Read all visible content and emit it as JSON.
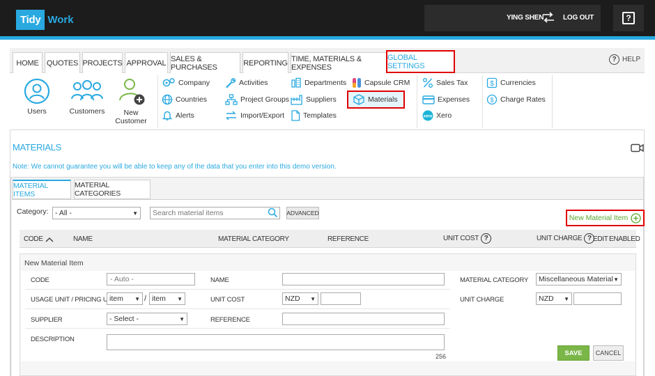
{
  "brand": {
    "logo_left": "Tidy",
    "logo_right": "Work",
    "accent": "#29a9e0"
  },
  "header": {
    "user_name": "YING SHEN",
    "logout": "LOG OUT",
    "help_glyph": "?"
  },
  "nav": {
    "tabs": [
      "HOME",
      "QUOTES",
      "PROJECTS",
      "APPROVAL",
      "SALES & PURCHASES",
      "REPORTING",
      "TIME, MATERIALS & EXPENSES",
      "GLOBAL SETTINGS"
    ],
    "active_tab": "GLOBAL SETTINGS",
    "help": "HELP"
  },
  "settings": {
    "users": "Users",
    "customers": "Customers",
    "new_customer_line1": "New",
    "new_customer_line2": "Customer",
    "company": "Company",
    "countries": "Countries",
    "alerts": "Alerts",
    "activities": "Activities",
    "project_groups": "Project Groups",
    "import_export": "Import/Export",
    "departments": "Departments",
    "suppliers": "Suppliers",
    "templates": "Templates",
    "capsule_crm": "Capsule CRM",
    "materials": "Materials",
    "sales_tax": "Sales Tax",
    "expenses": "Expenses",
    "xero": "Xero",
    "currencies": "Currencies",
    "charge_rates": "Charge Rates"
  },
  "page": {
    "title": "MATERIALS",
    "note": "Note: We cannot guarantee you will be able to keep any of the data that you enter into this demo version."
  },
  "subtabs": {
    "items": "MATERIAL ITEMS",
    "categories": "MATERIAL CATEGORIES"
  },
  "filters": {
    "category_label": "Category:",
    "category_value": "- All -",
    "search_placeholder": "Search material items",
    "advanced": "ADVANCED",
    "new_item": "New Material Item"
  },
  "table": {
    "code": "CODE",
    "name": "NAME",
    "category": "MATERIAL CATEGORY",
    "reference": "REFERENCE",
    "unit_cost": "UNIT COST",
    "unit_charge": "UNIT CHARGE",
    "edit": "EDIT",
    "enabled": "ENABLED"
  },
  "form": {
    "title": "New Material Item",
    "code_label": "CODE",
    "code_placeholder": "- Auto -",
    "name_label": "NAME",
    "category_label": "MATERIAL CATEGORY",
    "category_value": "Miscellaneous Materials",
    "usage_label": "USAGE UNIT / PRICING UNIT",
    "usage_unit": "item",
    "slash": "/",
    "pricing_unit": "item",
    "unit_cost_label": "UNIT COST",
    "cost_currency": "NZD",
    "unit_charge_label": "UNIT CHARGE",
    "charge_currency": "NZD",
    "supplier_label": "SUPPLIER",
    "supplier_value": "- Select -",
    "reference_label": "REFERENCE",
    "description_label": "DESCRIPTION",
    "char_count": "256",
    "save": "SAVE",
    "cancel": "CANCEL"
  },
  "icons": {
    "logout": "logout-arrows-icon",
    "help": "question-box-icon",
    "camera": "video-camera-icon",
    "search": "magnifier-icon",
    "add": "plus-circle-icon",
    "sort": "chevron-up-icon",
    "info": "question-circle-icon"
  },
  "colors": {
    "highlight": "#e00000",
    "save": "#7ab648",
    "new_item": "#5aa62e"
  }
}
